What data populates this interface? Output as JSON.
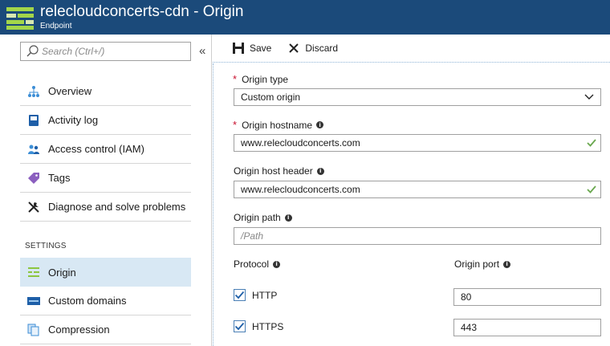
{
  "header": {
    "title": "relecloudconcerts-cdn - Origin",
    "subtitle": "Endpoint"
  },
  "sidebar": {
    "search_placeholder": "Search (Ctrl+/)",
    "collapse_glyph": "«",
    "items": [
      {
        "label": "Overview",
        "icon": "network-icon"
      },
      {
        "label": "Activity log",
        "icon": "book-icon"
      },
      {
        "label": "Access control (IAM)",
        "icon": "users-icon"
      },
      {
        "label": "Tags",
        "icon": "tag-icon"
      },
      {
        "label": "Diagnose and solve problems",
        "icon": "wrench-icon"
      }
    ],
    "section_label": "SETTINGS",
    "settings_items": [
      {
        "label": "Origin",
        "icon": "origin-icon",
        "active": true
      },
      {
        "label": "Custom domains",
        "icon": "www-icon"
      },
      {
        "label": "Compression",
        "icon": "compress-icon"
      }
    ]
  },
  "toolbar": {
    "save_label": "Save",
    "discard_label": "Discard"
  },
  "form": {
    "origin_type": {
      "label": "Origin type",
      "value": "Custom origin",
      "required": true
    },
    "origin_hostname": {
      "label": "Origin hostname",
      "value": "www.relecloudconcerts.com",
      "required": true
    },
    "origin_host_header": {
      "label": "Origin host header",
      "value": "www.relecloudconcerts.com"
    },
    "origin_path": {
      "label": "Origin path",
      "placeholder": "/Path"
    },
    "protocol": {
      "label": "Protocol"
    },
    "origin_port": {
      "label": "Origin port"
    },
    "http": {
      "label": "HTTP",
      "checked": true,
      "port": "80"
    },
    "https": {
      "label": "HTTPS",
      "checked": true,
      "port": "443"
    }
  },
  "colors": {
    "header_bg": "#1b4a7a",
    "accent": "#4a7fb5",
    "active_bg": "#d8e8f4",
    "check": "#6aa84f",
    "required": "#c8102e"
  }
}
